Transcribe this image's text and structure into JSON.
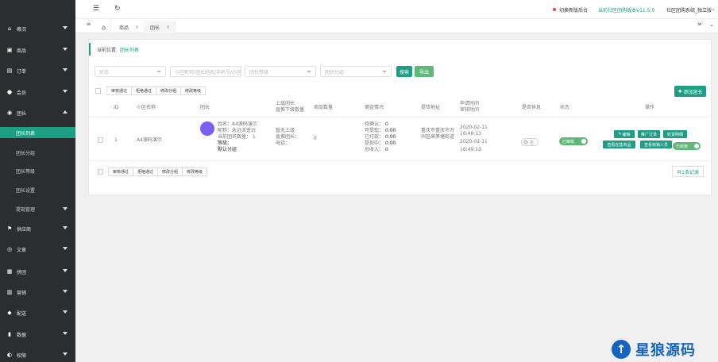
{
  "sidebar": {
    "items": [
      {
        "label": "概况",
        "icon": "home-icon",
        "glyph": "⌂"
      },
      {
        "label": "商品",
        "icon": "bag-icon",
        "glyph": "▣"
      },
      {
        "label": "订单",
        "icon": "order-icon",
        "glyph": "▤"
      },
      {
        "label": "会员",
        "icon": "user-icon",
        "glyph": "●"
      },
      {
        "label": "团长",
        "icon": "leader-icon",
        "glyph": "◉"
      },
      {
        "label": "供应商",
        "icon": "supplier-icon",
        "glyph": "⚑"
      },
      {
        "label": "文章",
        "icon": "compass-icon",
        "glyph": "◎"
      },
      {
        "label": "拼团",
        "icon": "group-icon",
        "glyph": "▦"
      },
      {
        "label": "营销",
        "icon": "marketing-icon",
        "glyph": "▥"
      },
      {
        "label": "配送",
        "icon": "truck-icon",
        "glyph": "◆"
      },
      {
        "label": "数据",
        "icon": "chart-icon",
        "glyph": "▮"
      },
      {
        "label": "权限",
        "icon": "lock-icon",
        "glyph": "◐"
      }
    ],
    "sub_items": [
      {
        "label": "团长列表"
      },
      {
        "label": "团长分组"
      },
      {
        "label": "团长等级"
      },
      {
        "label": "团长设置"
      },
      {
        "label": "提现管理"
      }
    ]
  },
  "topbar": {
    "switch_label": "切换新版后台",
    "version_label": "当前社区团购版本V11.5.0",
    "system_label": "社区团购系统_独立版"
  },
  "tabs": [
    {
      "label": "商品",
      "close": "×"
    },
    {
      "label": "团长",
      "close": "×"
    }
  ],
  "breadcrumb": {
    "prefix": "当前位置:",
    "current": "团长列表"
  },
  "filters": {
    "status_placeholder": "状态",
    "keyword_placeholder": "小区昵称/团长姓名/手机号/小区",
    "level_placeholder": "团长等级",
    "group_placeholder": "团长分组",
    "search_label": "搜索",
    "export_label": "导出",
    "add_label": "添加团长"
  },
  "bulk_actions": [
    "审核通过",
    "拒绝通过",
    "修改分组",
    "修改等级"
  ],
  "table": {
    "headers": {
      "id": "ID",
      "community": "小区名称",
      "leader": "团长",
      "upper1": "上级团长",
      "upper2": "直推下级数量",
      "goods": "商品数量",
      "commission": "佣金情况",
      "address": "提货地址",
      "apply1": "申请时间",
      "apply2": "审核时间",
      "rest": "是否休息",
      "status": "状态",
      "ops": "操作"
    },
    "row": {
      "id": "1",
      "community": "A4源码演示",
      "leader_lines": [
        "姓名：A4源码演示",
        "昵称：永远太遥远",
        "当前团员数量：  1"
      ],
      "level_label": "等级：",
      "group_label": "默认分组",
      "upper_lines": [
        "暂无上级",
        "直推团长：",
        "电话："
      ],
      "direct_count": "0",
      "commission_labels": [
        "待确认：",
        "可提现：",
        "已打款：",
        "提现中：",
        "总收入："
      ],
      "commission_values": [
        "0",
        "0.00",
        "0.00",
        "0.00",
        "0"
      ],
      "address": "重庆市重庆市万州区高笋塘街道",
      "apply_time_date": "2020-02-11",
      "apply_time_time": "16:49:13",
      "audit_time_date": "2020-02-11",
      "audit_time_time": "16:49:13",
      "rest_label": "否",
      "status_label": "已审核",
      "ops": {
        "edit": "编辑",
        "promote_orders": "推广订单",
        "receipt_detail": "收货明细",
        "view_sales": "查看在售商品",
        "view_couriers": "查看核销人员",
        "enabled": "已启用"
      }
    }
  },
  "pager": {
    "total_label": "共1条记录"
  },
  "watermark": {
    "logo_glyph": "↑",
    "text": "星狼源码"
  }
}
